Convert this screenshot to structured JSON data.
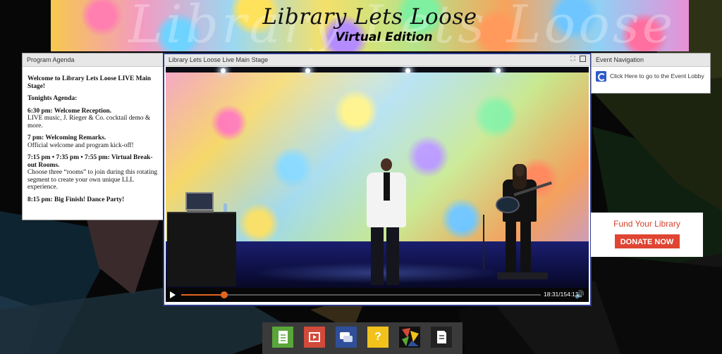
{
  "banner": {
    "title": "Library Lets Loose",
    "subtitle": "Virtual Edition",
    "ghost_text": "Library Lets Loose"
  },
  "agenda": {
    "header": "Program Agenda",
    "welcome": "Welcome to Library Lets Loose LIVE Main Stage!",
    "tonight": "Tonights Agenda:",
    "items": [
      {
        "title": "6:30 pm: Welcome Reception.",
        "desc": "LIVE music, J. Rieger & Co. cocktail demo & more."
      },
      {
        "title": "7 pm: Welcoming Remarks.",
        "desc": "Official welcome and program kick-off!"
      },
      {
        "title": "7:15 pm • 7:35 pm • 7:55 pm: Virtual Break-out Rooms.",
        "desc": "Choose three “rooms” to join during this rotating segment to create your own unique LLL experience."
      },
      {
        "title": "8:15 pm: Big Finish! Dance Party!",
        "desc": ""
      }
    ]
  },
  "stage": {
    "header": "Library Lets Loose Live Main Stage",
    "time": "18:31/154:13",
    "progress": 0.12
  },
  "eventnav": {
    "header": "Event Navigation",
    "lobby_label": "Click Here to go to the Event Lobby"
  },
  "fund": {
    "title": "Fund Your Library",
    "donate_label": "DONATE NOW"
  },
  "dock": {
    "items": [
      {
        "name": "document-icon",
        "color": "#5aa63a"
      },
      {
        "name": "video-icon",
        "color": "#d24a3a"
      },
      {
        "name": "chat-icon",
        "color": "#2f4f9a"
      },
      {
        "name": "help-icon",
        "color": "#f1c21b"
      },
      {
        "name": "mosaic-icon",
        "color": "#111111"
      },
      {
        "name": "page-icon",
        "color": "#222222"
      }
    ]
  },
  "colors": {
    "stage_border": "#2b3a8a",
    "accent": "#df4532",
    "progress": "#e2651f"
  }
}
